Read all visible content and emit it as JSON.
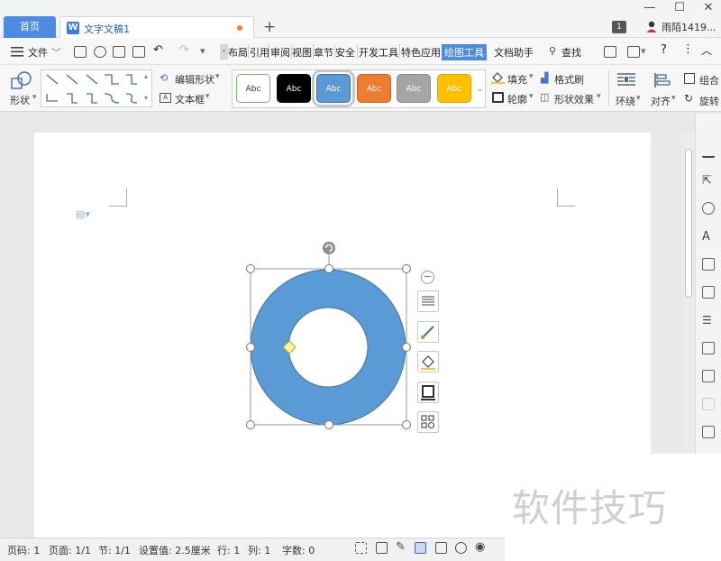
{
  "tabs": {
    "home": "首页",
    "document": "文字文稿1",
    "new_tab": "+"
  },
  "window": {
    "badge": "1",
    "user_name": "雨陌1419...",
    "minimize": "—",
    "maximize": "☐",
    "close": "✕"
  },
  "menu": {
    "file": "文件",
    "items_visible": [
      "布局",
      "引用",
      "审阅",
      "视图",
      "章节",
      "安全",
      "开发工具",
      "特色应用",
      "绘图工具",
      "文档助手"
    ],
    "active": "绘图工具",
    "search": "查找"
  },
  "ribbon": {
    "shape_label": "形状",
    "edit_shape": "编辑形状",
    "textbox": "文本框",
    "style_swatches": [
      {
        "text": "Abc",
        "bg": "#ffffff",
        "fg": "#333333",
        "border": "#7ab46a"
      },
      {
        "text": "Abc",
        "bg": "#000000",
        "fg": "#ffffff",
        "border": "#000000"
      },
      {
        "text": "Abc",
        "bg": "#5b9bd5",
        "fg": "#ffffff",
        "border": "#41719c"
      },
      {
        "text": "Abc",
        "bg": "#ed7d31",
        "fg": "#ffffff",
        "border": "#c9651f"
      },
      {
        "text": "Abc",
        "bg": "#a5a5a5",
        "fg": "#ffffff",
        "border": "#8a8a8a"
      },
      {
        "text": "Abc",
        "bg": "#ffc000",
        "fg": "#ffffff",
        "border": "#d9a300"
      }
    ],
    "fill": "填充",
    "outline": "轮廓",
    "format_painter": "格式刷",
    "shape_effect": "形状效果",
    "wrap": "环绕",
    "align": "对齐",
    "group": "组合",
    "rotate": "旋转"
  },
  "shape": {
    "fill_color": "#5b9bd5",
    "stroke_color": "#41719c"
  },
  "status": {
    "page_num": "页码: 1",
    "pages": "页面: 1/1",
    "section": "节: 1/1",
    "setting": "设置值: 2.5厘米",
    "row": "行: 1",
    "col": "列: 1",
    "word_count": "字数: 0"
  },
  "watermark": "软件技巧",
  "colors": {
    "accent": "#4b8be0",
    "ring": "#5b9bd5"
  }
}
